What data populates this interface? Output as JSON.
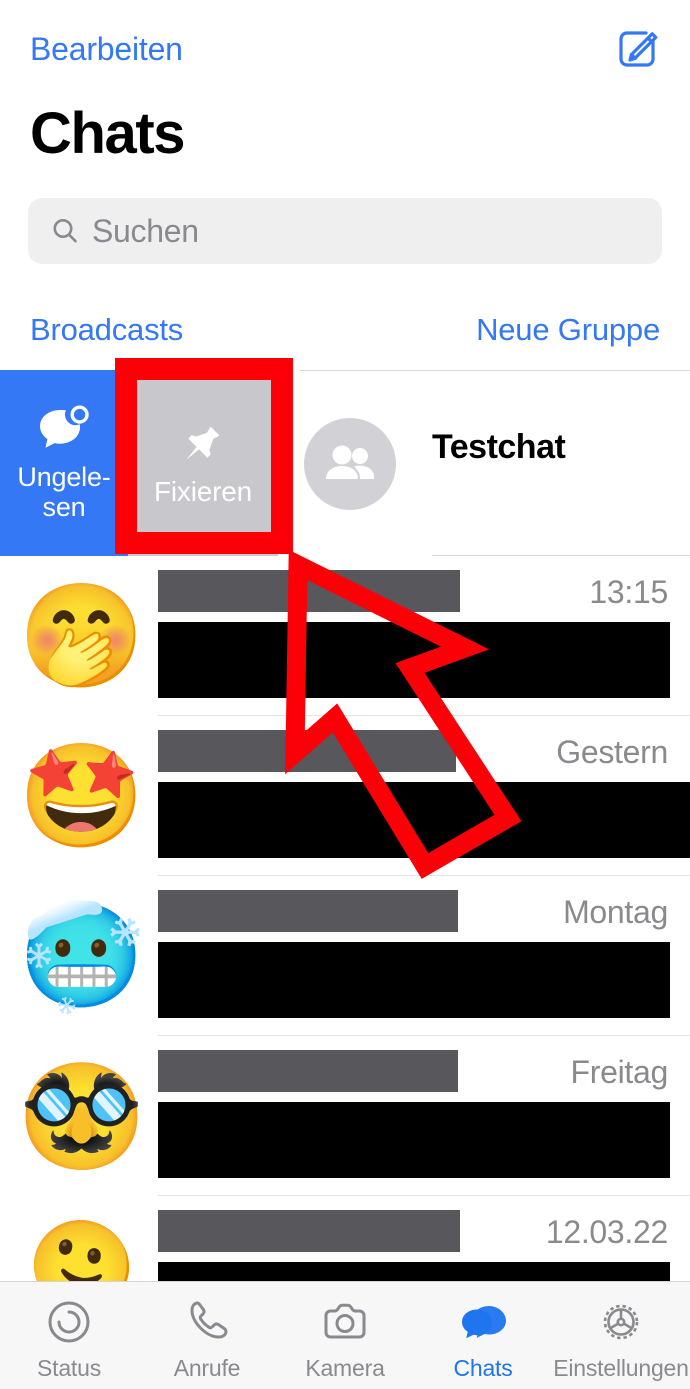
{
  "navbar": {
    "edit_label": "Bearbeiten",
    "compose_icon": "compose-icon",
    "accent_color": "#3478F6"
  },
  "page_title": "Chats",
  "search": {
    "placeholder": "Suchen",
    "icon": "search-icon",
    "background": "#EFEFF0"
  },
  "quick_actions": {
    "left_label": "Broadcasts",
    "right_label": "Neue Gruppe"
  },
  "swiped_row": {
    "name": "Testchat",
    "avatar_icon": "group-people-icon",
    "actions": [
      {
        "label": "Ungelesen",
        "label_line1": "Ungele-",
        "label_line2": "sen",
        "icon": "unread-bubble-icon",
        "color": "#3478F6"
      },
      {
        "label": "Fixieren",
        "icon": "pin-icon",
        "color": "#C7C7CC"
      }
    ]
  },
  "chat_rows": [
    {
      "avatar": "🤭",
      "time": "13:15",
      "name_bar_width": 302,
      "msg_bar_width": 512
    },
    {
      "avatar": "🤩",
      "time": "Gestern",
      "name_bar_width": 298,
      "msg_bar_width": 532
    },
    {
      "avatar": "🥶",
      "time": "Montag",
      "name_bar_width": 300,
      "msg_bar_width": 512
    },
    {
      "avatar": "🥸",
      "time": "Freitag",
      "name_bar_width": 300,
      "msg_bar_width": 512
    },
    {
      "avatar": "🫠",
      "time": "12.03.22",
      "name_bar_width": 302,
      "msg_bar_width": 512
    }
  ],
  "tabbar": {
    "items": [
      {
        "label": "Status",
        "icon": "status-rings-icon",
        "active": false
      },
      {
        "label": "Anrufe",
        "icon": "phone-icon",
        "active": false
      },
      {
        "label": "Kamera",
        "icon": "camera-icon",
        "active": false
      },
      {
        "label": "Chats",
        "icon": "chat-bubbles-icon",
        "active": true
      },
      {
        "label": "Einstellungen",
        "icon": "gear-icon",
        "active": false
      }
    ],
    "active_color": "#1F74F0",
    "inactive_color": "#8A8A8E"
  },
  "annotations": {
    "highlight_color": "#FB0007",
    "highlight_target": "Fixieren",
    "arrow_color": "#FB0007",
    "arrow_points_to": "Fixieren"
  }
}
